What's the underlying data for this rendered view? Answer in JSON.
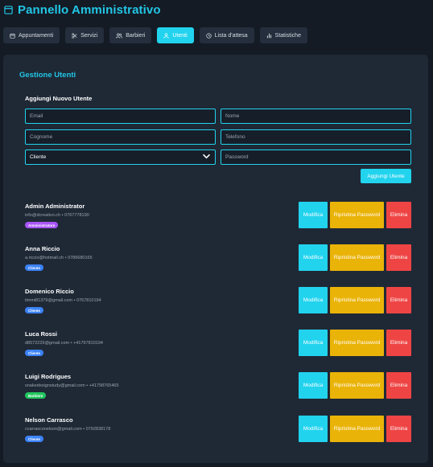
{
  "app": {
    "title": "Pannello Amministrativo",
    "accent": "#22d3ee"
  },
  "tabs": [
    {
      "label": "Appuntamenti",
      "icon": "calendar-icon",
      "active": false
    },
    {
      "label": "Servizi",
      "icon": "scissors-icon",
      "active": false
    },
    {
      "label": "Barbieri",
      "icon": "users-icon",
      "active": false
    },
    {
      "label": "Utenti",
      "icon": "user-icon",
      "active": true
    },
    {
      "label": "Lista d'attesa",
      "icon": "clock-icon",
      "active": false
    },
    {
      "label": "Statistiche",
      "icon": "bar-chart-icon",
      "active": false
    }
  ],
  "panel": {
    "title": "Gestione Utenti",
    "form": {
      "title": "Aggiungi Nuovo Utente",
      "email_placeholder": "Email",
      "nome_placeholder": "Nome",
      "cognome_placeholder": "Cognome",
      "telefono_placeholder": "Telefono",
      "role_selected": "Cliente",
      "password_placeholder": "Password",
      "submit_label": "Aggiungi Utente"
    },
    "actions": {
      "edit_label": "Modifica",
      "reset_label": "Ripristina Password",
      "delete_label": "Elimina"
    },
    "users": [
      {
        "name": "Admin Administrator",
        "email": "info@dcreativo.ch",
        "phone": "0767778190",
        "role": "Amministratore",
        "role_color": "#a855f7"
      },
      {
        "name": "Anna Riccio",
        "email": "a.riccio@hotmail.ch",
        "phone": "0786680165",
        "role": "Cliente",
        "role_color": "#3b82f6"
      },
      {
        "name": "Domenico Riccio",
        "email": "timmi81379@gmail.com",
        "phone": "0767810194",
        "role": "Cliente",
        "role_color": "#3b82f6"
      },
      {
        "name": "Luca Rossi",
        "email": "d8572229@gmail.com",
        "phone": "+41767810194",
        "role": "Cliente",
        "role_color": "#3b82f6"
      },
      {
        "name": "Luigi Rodrigues",
        "email": "snakedesignstudy@gmail.com",
        "phone": "+41798765465",
        "role": "Barbiere",
        "role_color": "#22c55e"
      },
      {
        "name": "Nelson Carrasco",
        "email": "ccarrasconelson@gmail.com",
        "phone": "0792838178",
        "role": "Cliente",
        "role_color": "#3b82f6"
      }
    ]
  }
}
